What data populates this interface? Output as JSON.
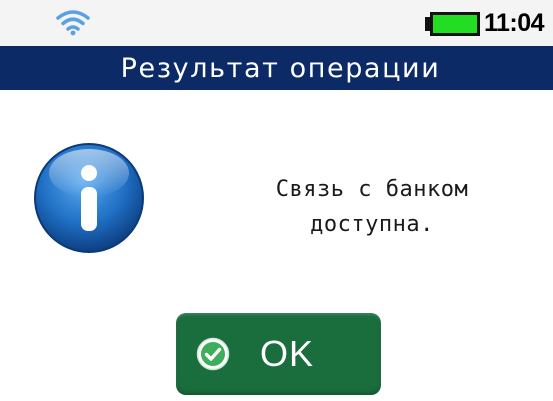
{
  "status": {
    "wifi_icon": "wifi-icon",
    "battery_icon": "battery-icon",
    "battery_color": "#22dd22",
    "time": "11:04"
  },
  "header": {
    "title": "Результат операции",
    "background": "#0c2a66"
  },
  "dialog": {
    "icon": "info-icon",
    "message_lines": [
      "Связь с банком",
      "доступна."
    ],
    "ok_button": {
      "icon": "check-icon",
      "label": "OK",
      "color": "#1a6e3e"
    }
  }
}
